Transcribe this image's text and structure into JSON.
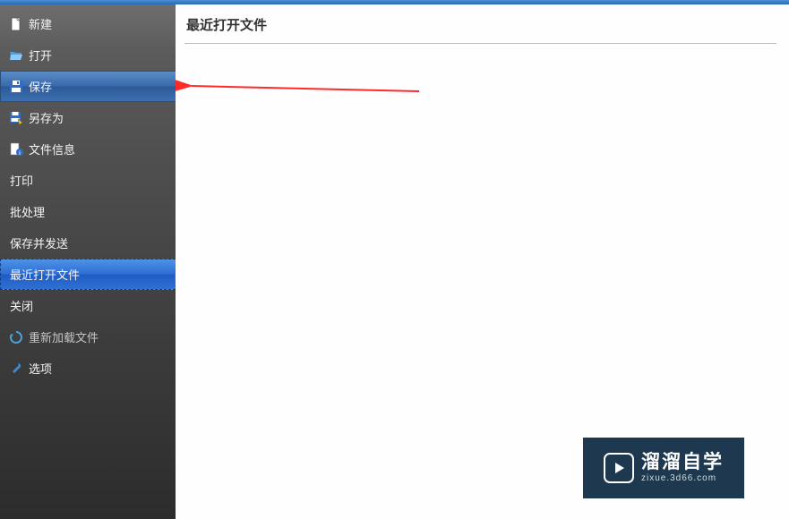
{
  "sidebar": {
    "items": [
      {
        "id": "new",
        "label": "新建",
        "icon": "file-new-icon",
        "hasIcon": true,
        "state": ""
      },
      {
        "id": "open",
        "label": "打开",
        "icon": "folder-open-icon",
        "hasIcon": true,
        "state": ""
      },
      {
        "id": "save",
        "label": "保存",
        "icon": "save-icon",
        "hasIcon": true,
        "state": "selected"
      },
      {
        "id": "saveas",
        "label": "另存为",
        "icon": "save-as-icon",
        "hasIcon": true,
        "state": ""
      },
      {
        "id": "fileinfo",
        "label": "文件信息",
        "icon": "info-icon",
        "hasIcon": true,
        "state": ""
      },
      {
        "id": "print",
        "label": "打印",
        "icon": "",
        "hasIcon": false,
        "state": ""
      },
      {
        "id": "batch",
        "label": "批处理",
        "icon": "",
        "hasIcon": false,
        "state": ""
      },
      {
        "id": "savesend",
        "label": "保存并发送",
        "icon": "",
        "hasIcon": false,
        "state": ""
      },
      {
        "id": "recent",
        "label": "最近打开文件",
        "icon": "",
        "hasIcon": false,
        "state": "active-blue"
      },
      {
        "id": "close",
        "label": "关闭",
        "icon": "",
        "hasIcon": false,
        "state": ""
      },
      {
        "id": "reload",
        "label": "重新加载文件",
        "icon": "reload-icon",
        "hasIcon": true,
        "state": "disabled"
      },
      {
        "id": "options",
        "label": "选项",
        "icon": "wrench-icon",
        "hasIcon": true,
        "state": ""
      }
    ]
  },
  "content": {
    "title": "最近打开文件"
  },
  "watermark": {
    "line1": "溜溜自学",
    "line2": "zixue.3d66.com"
  },
  "colors": {
    "arrow": "#ff2a2a"
  }
}
